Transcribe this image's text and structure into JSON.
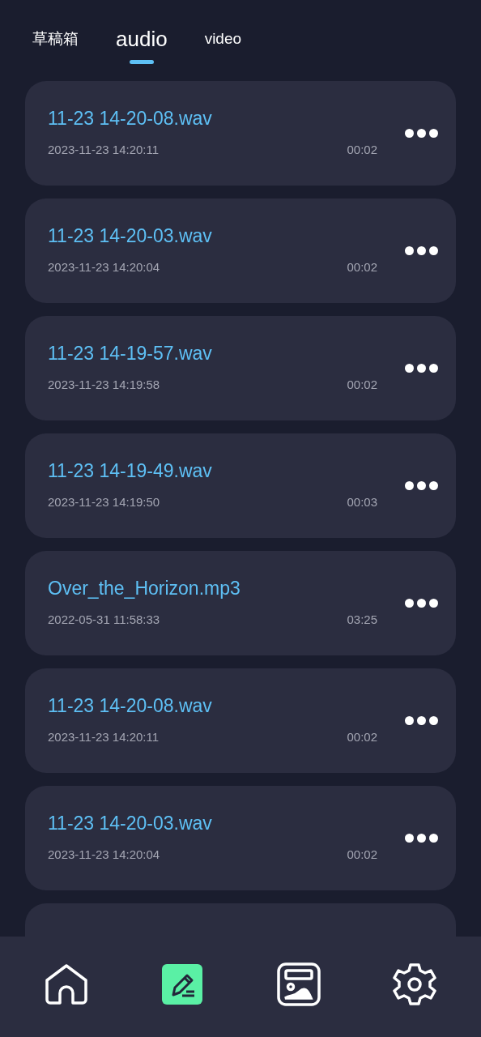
{
  "tabs": [
    {
      "label": "草稿箱",
      "selected": false
    },
    {
      "label": "audio",
      "selected": true
    },
    {
      "label": "video",
      "selected": false
    }
  ],
  "files": [
    {
      "name": "11-23 14-20-08.wav",
      "date": "2023-11-23 14:20:11",
      "duration": "00:02"
    },
    {
      "name": "11-23 14-20-03.wav",
      "date": "2023-11-23 14:20:04",
      "duration": "00:02"
    },
    {
      "name": "11-23 14-19-57.wav",
      "date": "2023-11-23 14:19:58",
      "duration": "00:02"
    },
    {
      "name": "11-23 14-19-49.wav",
      "date": "2023-11-23 14:19:50",
      "duration": "00:03"
    },
    {
      "name": "Over_the_Horizon.mp3",
      "date": "2022-05-31 11:58:33",
      "duration": "03:25"
    },
    {
      "name": "11-23 14-20-08.wav",
      "date": "2023-11-23 14:20:11",
      "duration": "00:02"
    },
    {
      "name": "11-23 14-20-03.wav",
      "date": "2023-11-23 14:20:04",
      "duration": "00:02"
    }
  ],
  "nav": [
    {
      "kind": "home",
      "selected": false
    },
    {
      "kind": "edit",
      "selected": true
    },
    {
      "kind": "gallery",
      "selected": false
    },
    {
      "kind": "settings",
      "selected": false
    }
  ]
}
